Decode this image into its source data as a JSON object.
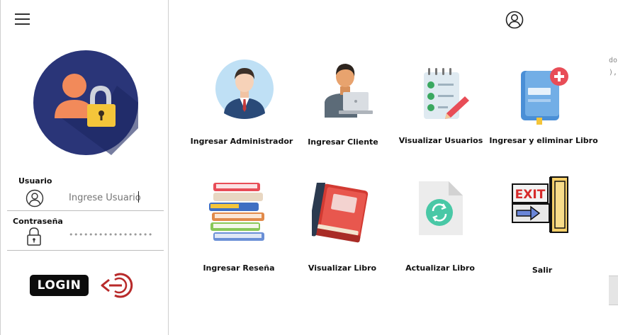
{
  "sidebar": {
    "user_label": "Usuario",
    "user_placeholder": "Ingrese Usuario",
    "password_label": "Contraseña",
    "password_mask": "•••••••••••••••••",
    "login_label": "LOGIN"
  },
  "menu": {
    "items": [
      {
        "label": "Ingresar Administrador",
        "icon": "admin-avatar-icon"
      },
      {
        "label": "Ingresar Cliente",
        "icon": "client-laptop-icon"
      },
      {
        "label": "Visualizar Usuarios",
        "icon": "checklist-icon"
      },
      {
        "label": "Ingresar y eliminar Libro",
        "icon": "add-book-icon"
      },
      {
        "label": "Ingresar Reseña",
        "icon": "book-stack-icon"
      },
      {
        "label": "Visualizar Libro",
        "icon": "red-book-icon"
      },
      {
        "label": "Actualizar Libro",
        "icon": "update-file-icon"
      },
      {
        "label": "Salir",
        "icon": "exit-door-icon"
      }
    ],
    "exit_sign_text": "EXIT"
  },
  "edge_text": {
    "line1": "do",
    "line2": "),"
  },
  "colors": {
    "circle_bg": "#2a3578",
    "lock_yellow": "#f4c53a",
    "person_orange": "#f28a5a",
    "login_arrow": "#b82a2a",
    "exit_red": "#d62b2b"
  }
}
